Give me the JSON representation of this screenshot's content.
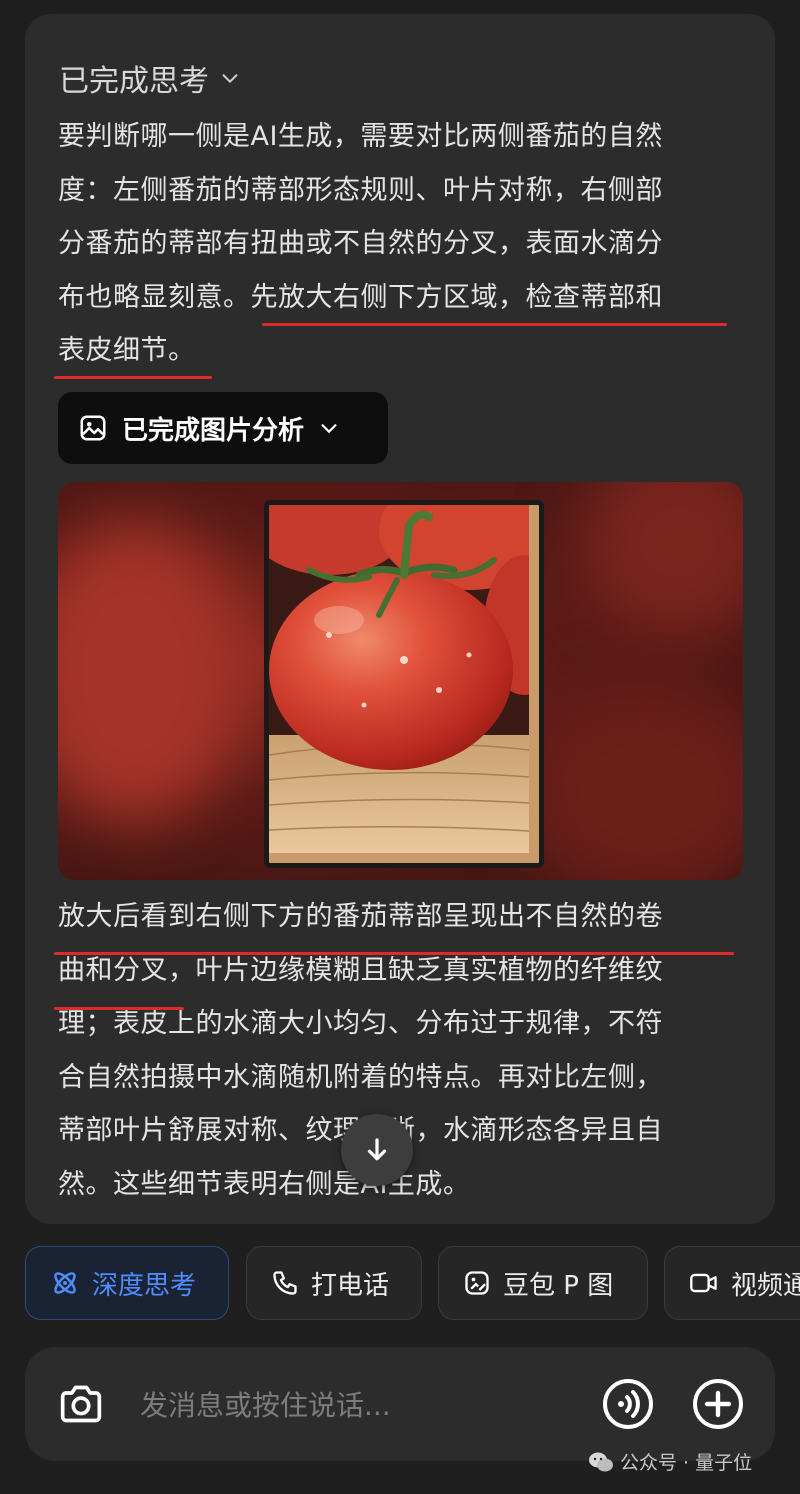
{
  "thinking": {
    "header": "已完成思考",
    "paragraph1_lines": [
      "要判断哪一侧是AI生成，需要对比两侧番茄的自然",
      "度：左侧番茄的蒂部形态规则、叶片对称，右侧部",
      "分番茄的蒂部有扭曲或不自然的分叉，表面水滴分",
      "布也略显刻意。先放大右侧下方区域，检查蒂部和",
      "表皮细节。"
    ]
  },
  "analysis_button": {
    "label": "已完成图片分析"
  },
  "paragraph2_lines": [
    "放大后看到右侧下方的番茄蒂部呈现出不自然的卷",
    "曲和分叉，叶片边缘模糊且缺乏真实植物的纤维纹",
    "理；表皮上的水滴大小均匀、分布过于规律，不符",
    "合自然拍摄中水滴随机附着的特点。再对比左侧，",
    "蒂部叶片舒展对称、纹理清晰，水滴形态各异且自",
    "然。这些细节表明右侧是AI生成。"
  ],
  "chips": [
    {
      "label": "深度思考",
      "icon": "atom-icon",
      "active": true
    },
    {
      "label": "打电话",
      "icon": "phone-icon",
      "active": false
    },
    {
      "label": "豆包 P 图",
      "icon": "image-edit-icon",
      "active": false
    },
    {
      "label": "视频通",
      "icon": "video-icon",
      "active": false
    }
  ],
  "input": {
    "placeholder": "发消息或按住说话..."
  },
  "watermark": "公众号 · 量子位",
  "colors": {
    "underline": "#e02a2a",
    "active_chip_text": "#4d8dff"
  }
}
